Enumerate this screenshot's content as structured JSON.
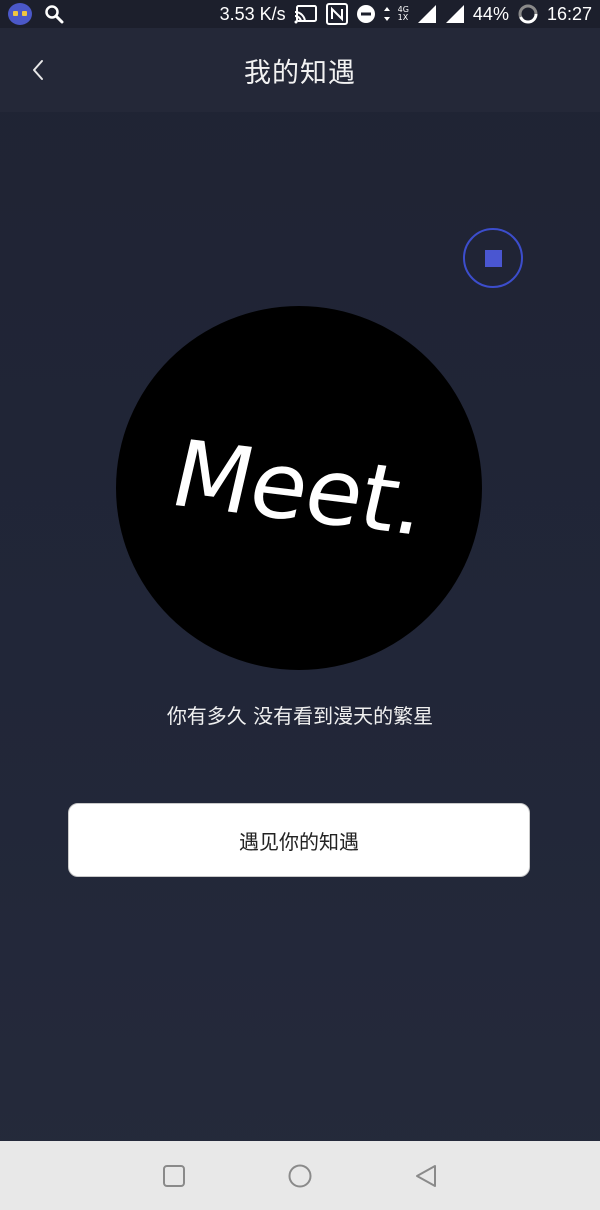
{
  "status_bar": {
    "speed": "3.53 K/s",
    "network_top": "4G",
    "network_bottom": "1X",
    "battery": "44%",
    "time": "16:27",
    "icons": [
      "app-avatar-icon",
      "search-icon",
      "cast-icon",
      "nfc-icon",
      "do-not-disturb-icon",
      "signal-icon",
      "signal-icon-2",
      "battery-ring-icon"
    ]
  },
  "header": {
    "title": "我的知遇",
    "back_icon": "chevron-left-icon"
  },
  "player": {
    "stop_icon": "stop-icon",
    "accent_color": "#3c4dcc"
  },
  "logo": {
    "text": "Meet."
  },
  "main": {
    "tagline": "你有多久 没有看到漫天的繁星",
    "cta_label": "遇见你的知遇"
  },
  "nav_bar": {
    "icons": [
      "recent-apps-icon",
      "home-icon",
      "back-icon"
    ]
  }
}
